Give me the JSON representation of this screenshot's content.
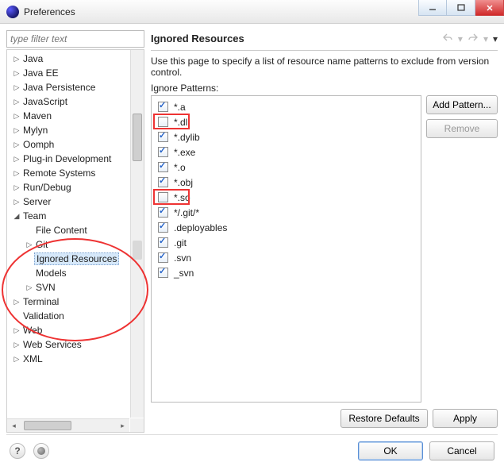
{
  "window": {
    "title": "Preferences"
  },
  "filter": {
    "placeholder": "type filter text"
  },
  "tree": [
    {
      "label": "Java",
      "depth": 0,
      "expander": "▷",
      "selected": false
    },
    {
      "label": "Java EE",
      "depth": 0,
      "expander": "▷",
      "selected": false
    },
    {
      "label": "Java Persistence",
      "depth": 0,
      "expander": "▷",
      "selected": false
    },
    {
      "label": "JavaScript",
      "depth": 0,
      "expander": "▷",
      "selected": false
    },
    {
      "label": "Maven",
      "depth": 0,
      "expander": "▷",
      "selected": false
    },
    {
      "label": "Mylyn",
      "depth": 0,
      "expander": "▷",
      "selected": false
    },
    {
      "label": "Oomph",
      "depth": 0,
      "expander": "▷",
      "selected": false
    },
    {
      "label": "Plug-in Development",
      "depth": 0,
      "expander": "▷",
      "selected": false
    },
    {
      "label": "Remote Systems",
      "depth": 0,
      "expander": "▷",
      "selected": false
    },
    {
      "label": "Run/Debug",
      "depth": 0,
      "expander": "▷",
      "selected": false
    },
    {
      "label": "Server",
      "depth": 0,
      "expander": "▷",
      "selected": false
    },
    {
      "label": "Team",
      "depth": 0,
      "expander": "◢",
      "selected": false
    },
    {
      "label": "File Content",
      "depth": 1,
      "expander": "",
      "selected": false
    },
    {
      "label": "Git",
      "depth": 1,
      "expander": "▷",
      "selected": false
    },
    {
      "label": "Ignored Resources",
      "depth": 1,
      "expander": "",
      "selected": true
    },
    {
      "label": "Models",
      "depth": 1,
      "expander": "",
      "selected": false
    },
    {
      "label": "SVN",
      "depth": 1,
      "expander": "▷",
      "selected": false
    },
    {
      "label": "Terminal",
      "depth": 0,
      "expander": "▷",
      "selected": false
    },
    {
      "label": "Validation",
      "depth": 0,
      "expander": "",
      "selected": false
    },
    {
      "label": "Web",
      "depth": 0,
      "expander": "▷",
      "selected": false
    },
    {
      "label": "Web Services",
      "depth": 0,
      "expander": "▷",
      "selected": false
    },
    {
      "label": "XML",
      "depth": 0,
      "expander": "▷",
      "selected": false
    }
  ],
  "right": {
    "title": "Ignored Resources",
    "description": "Use this page to specify a list of resource name patterns to exclude from version control.",
    "patterns_label": "Ignore Patterns:",
    "patterns": [
      {
        "label": "*.a",
        "checked": true
      },
      {
        "label": "*.dll",
        "checked": false
      },
      {
        "label": "*.dylib",
        "checked": true
      },
      {
        "label": "*.exe",
        "checked": true
      },
      {
        "label": "*.o",
        "checked": true
      },
      {
        "label": "*.obj",
        "checked": true
      },
      {
        "label": "*.so",
        "checked": false
      },
      {
        "label": "*/.git/*",
        "checked": true
      },
      {
        "label": ".deployables",
        "checked": true
      },
      {
        "label": ".git",
        "checked": true
      },
      {
        "label": ".svn",
        "checked": true
      },
      {
        "label": "_svn",
        "checked": true
      }
    ],
    "buttons": {
      "add": "Add Pattern...",
      "remove": "Remove",
      "restore": "Restore Defaults",
      "apply": "Apply"
    }
  },
  "footer": {
    "ok": "OK",
    "cancel": "Cancel"
  },
  "annotations": {
    "ellipse_note": "red ellipse around Team subtree",
    "box1_note": "red box on *.dll row",
    "box2_note": "red box on *.so row"
  }
}
